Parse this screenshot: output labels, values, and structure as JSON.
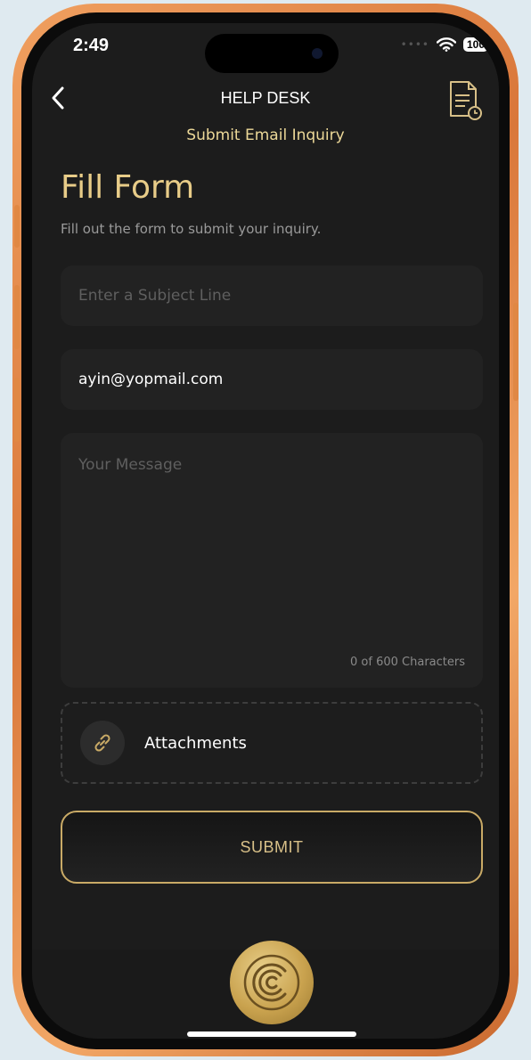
{
  "status": {
    "time": "2:49",
    "battery": "100",
    "signal_dots": "••••"
  },
  "header": {
    "title": "HELP DESK",
    "subtitle": "Submit Email Inquiry"
  },
  "form": {
    "title": "Fill Form",
    "description": "Fill out the form to submit your inquiry.",
    "subject_placeholder": "Enter a Subject Line",
    "email_value": "ayin@yopmail.com",
    "message_placeholder": "Your Message",
    "char_counter": "0 of 600 Characters",
    "attachments_label": "Attachments",
    "submit_label": "SUBMIT"
  },
  "colors": {
    "accent_gold": "#e8cc88",
    "background": "#1c1c1c",
    "field_background": "#222222",
    "frame_orange": "#e08844"
  },
  "icons": {
    "back": "chevron-left-icon",
    "history": "document-clock-icon",
    "attachment": "link-icon",
    "logo": "brand-logo-icon"
  }
}
